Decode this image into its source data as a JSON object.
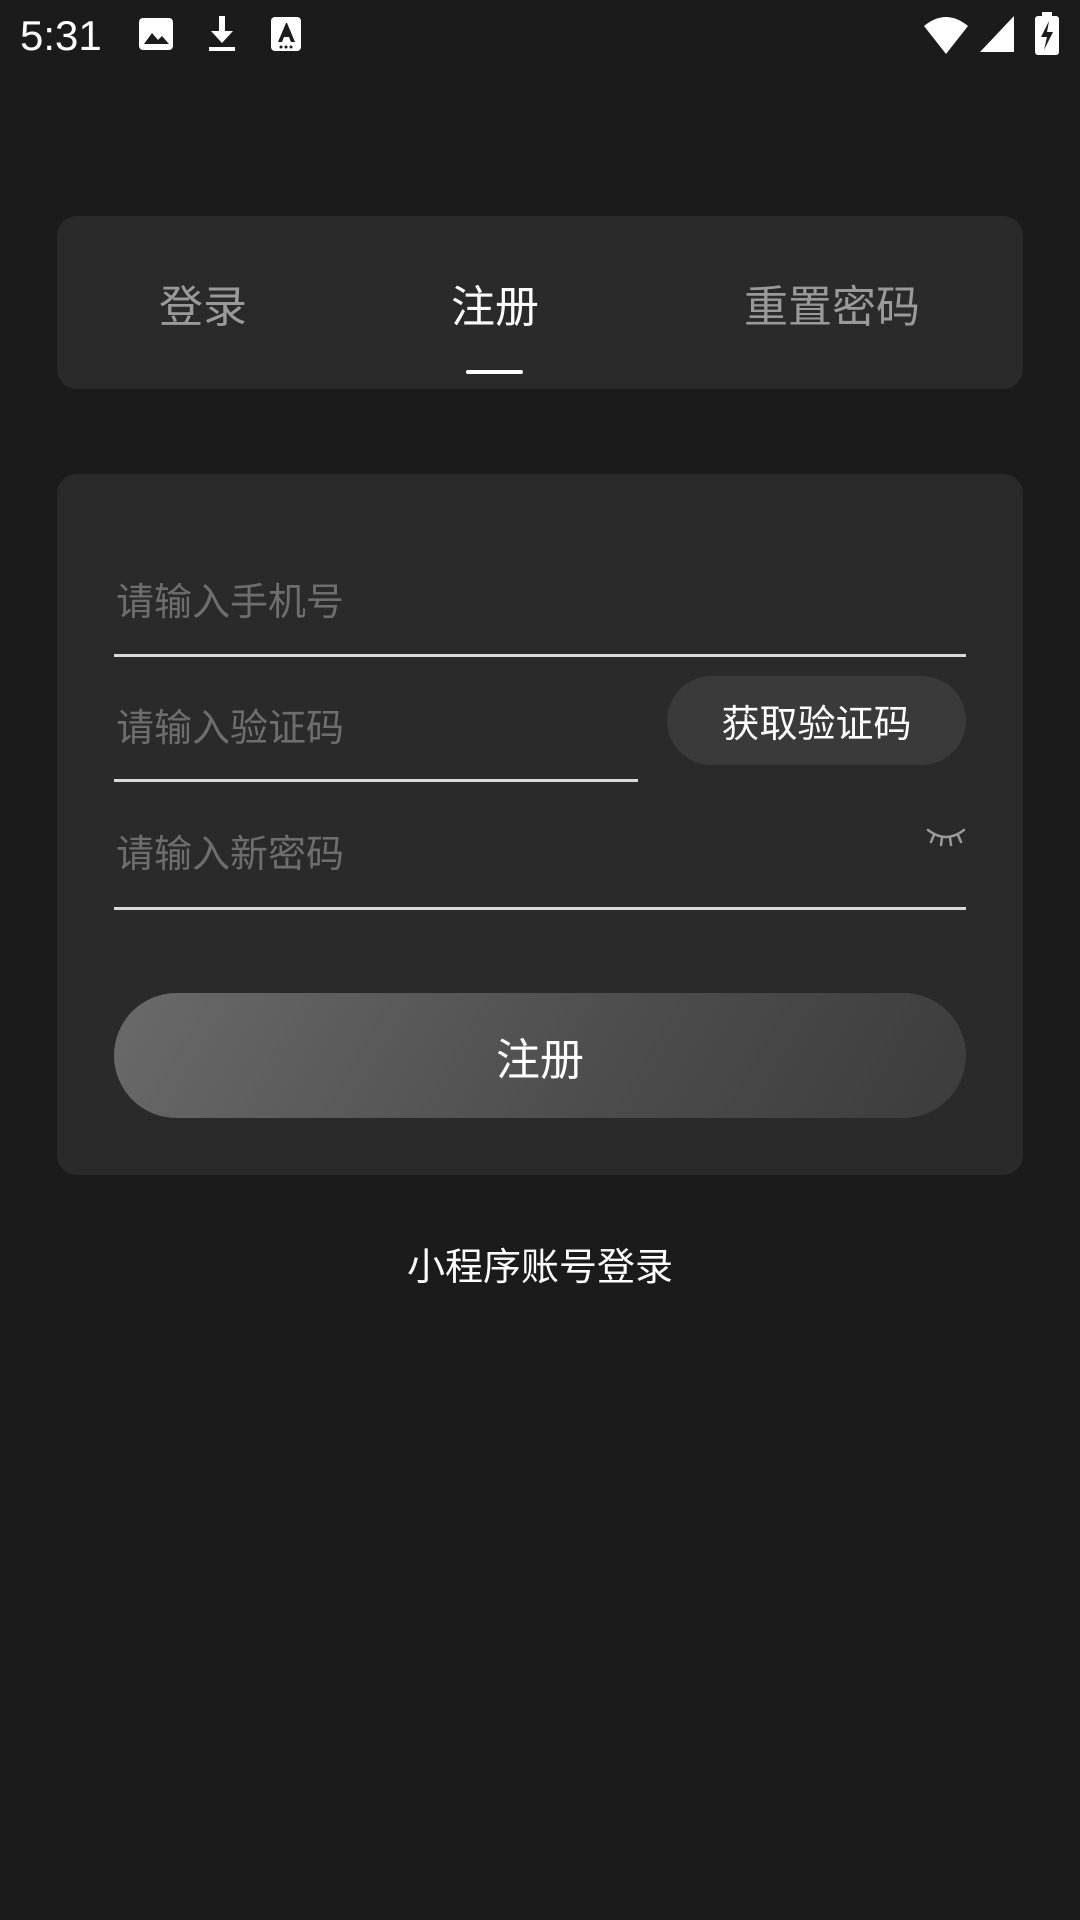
{
  "status_bar": {
    "time": "5:31",
    "left_icons": [
      "image-icon",
      "download-icon",
      "text-recognition-icon"
    ],
    "right_icons": [
      "wifi-icon",
      "cell-signal-icon",
      "battery-charging-icon"
    ]
  },
  "tabs": [
    {
      "label": "登录",
      "active": false
    },
    {
      "label": "注册",
      "active": true
    },
    {
      "label": "重置密码",
      "active": false
    }
  ],
  "form": {
    "phone_placeholder": "请输入手机号",
    "phone_value": "",
    "code_placeholder": "请输入验证码",
    "code_value": "",
    "get_code_label": "获取验证码",
    "password_placeholder": "请输入新密码",
    "password_value": "",
    "password_toggle_icon": "eye-closed-icon",
    "submit_label": "注册"
  },
  "mini_program_login_label": "小程序账号登录",
  "colors": {
    "background": "#1b1b1b",
    "card": "#2a2a2a",
    "inactive_tab": "#9a9a9a",
    "placeholder": "#6e6e6e"
  }
}
